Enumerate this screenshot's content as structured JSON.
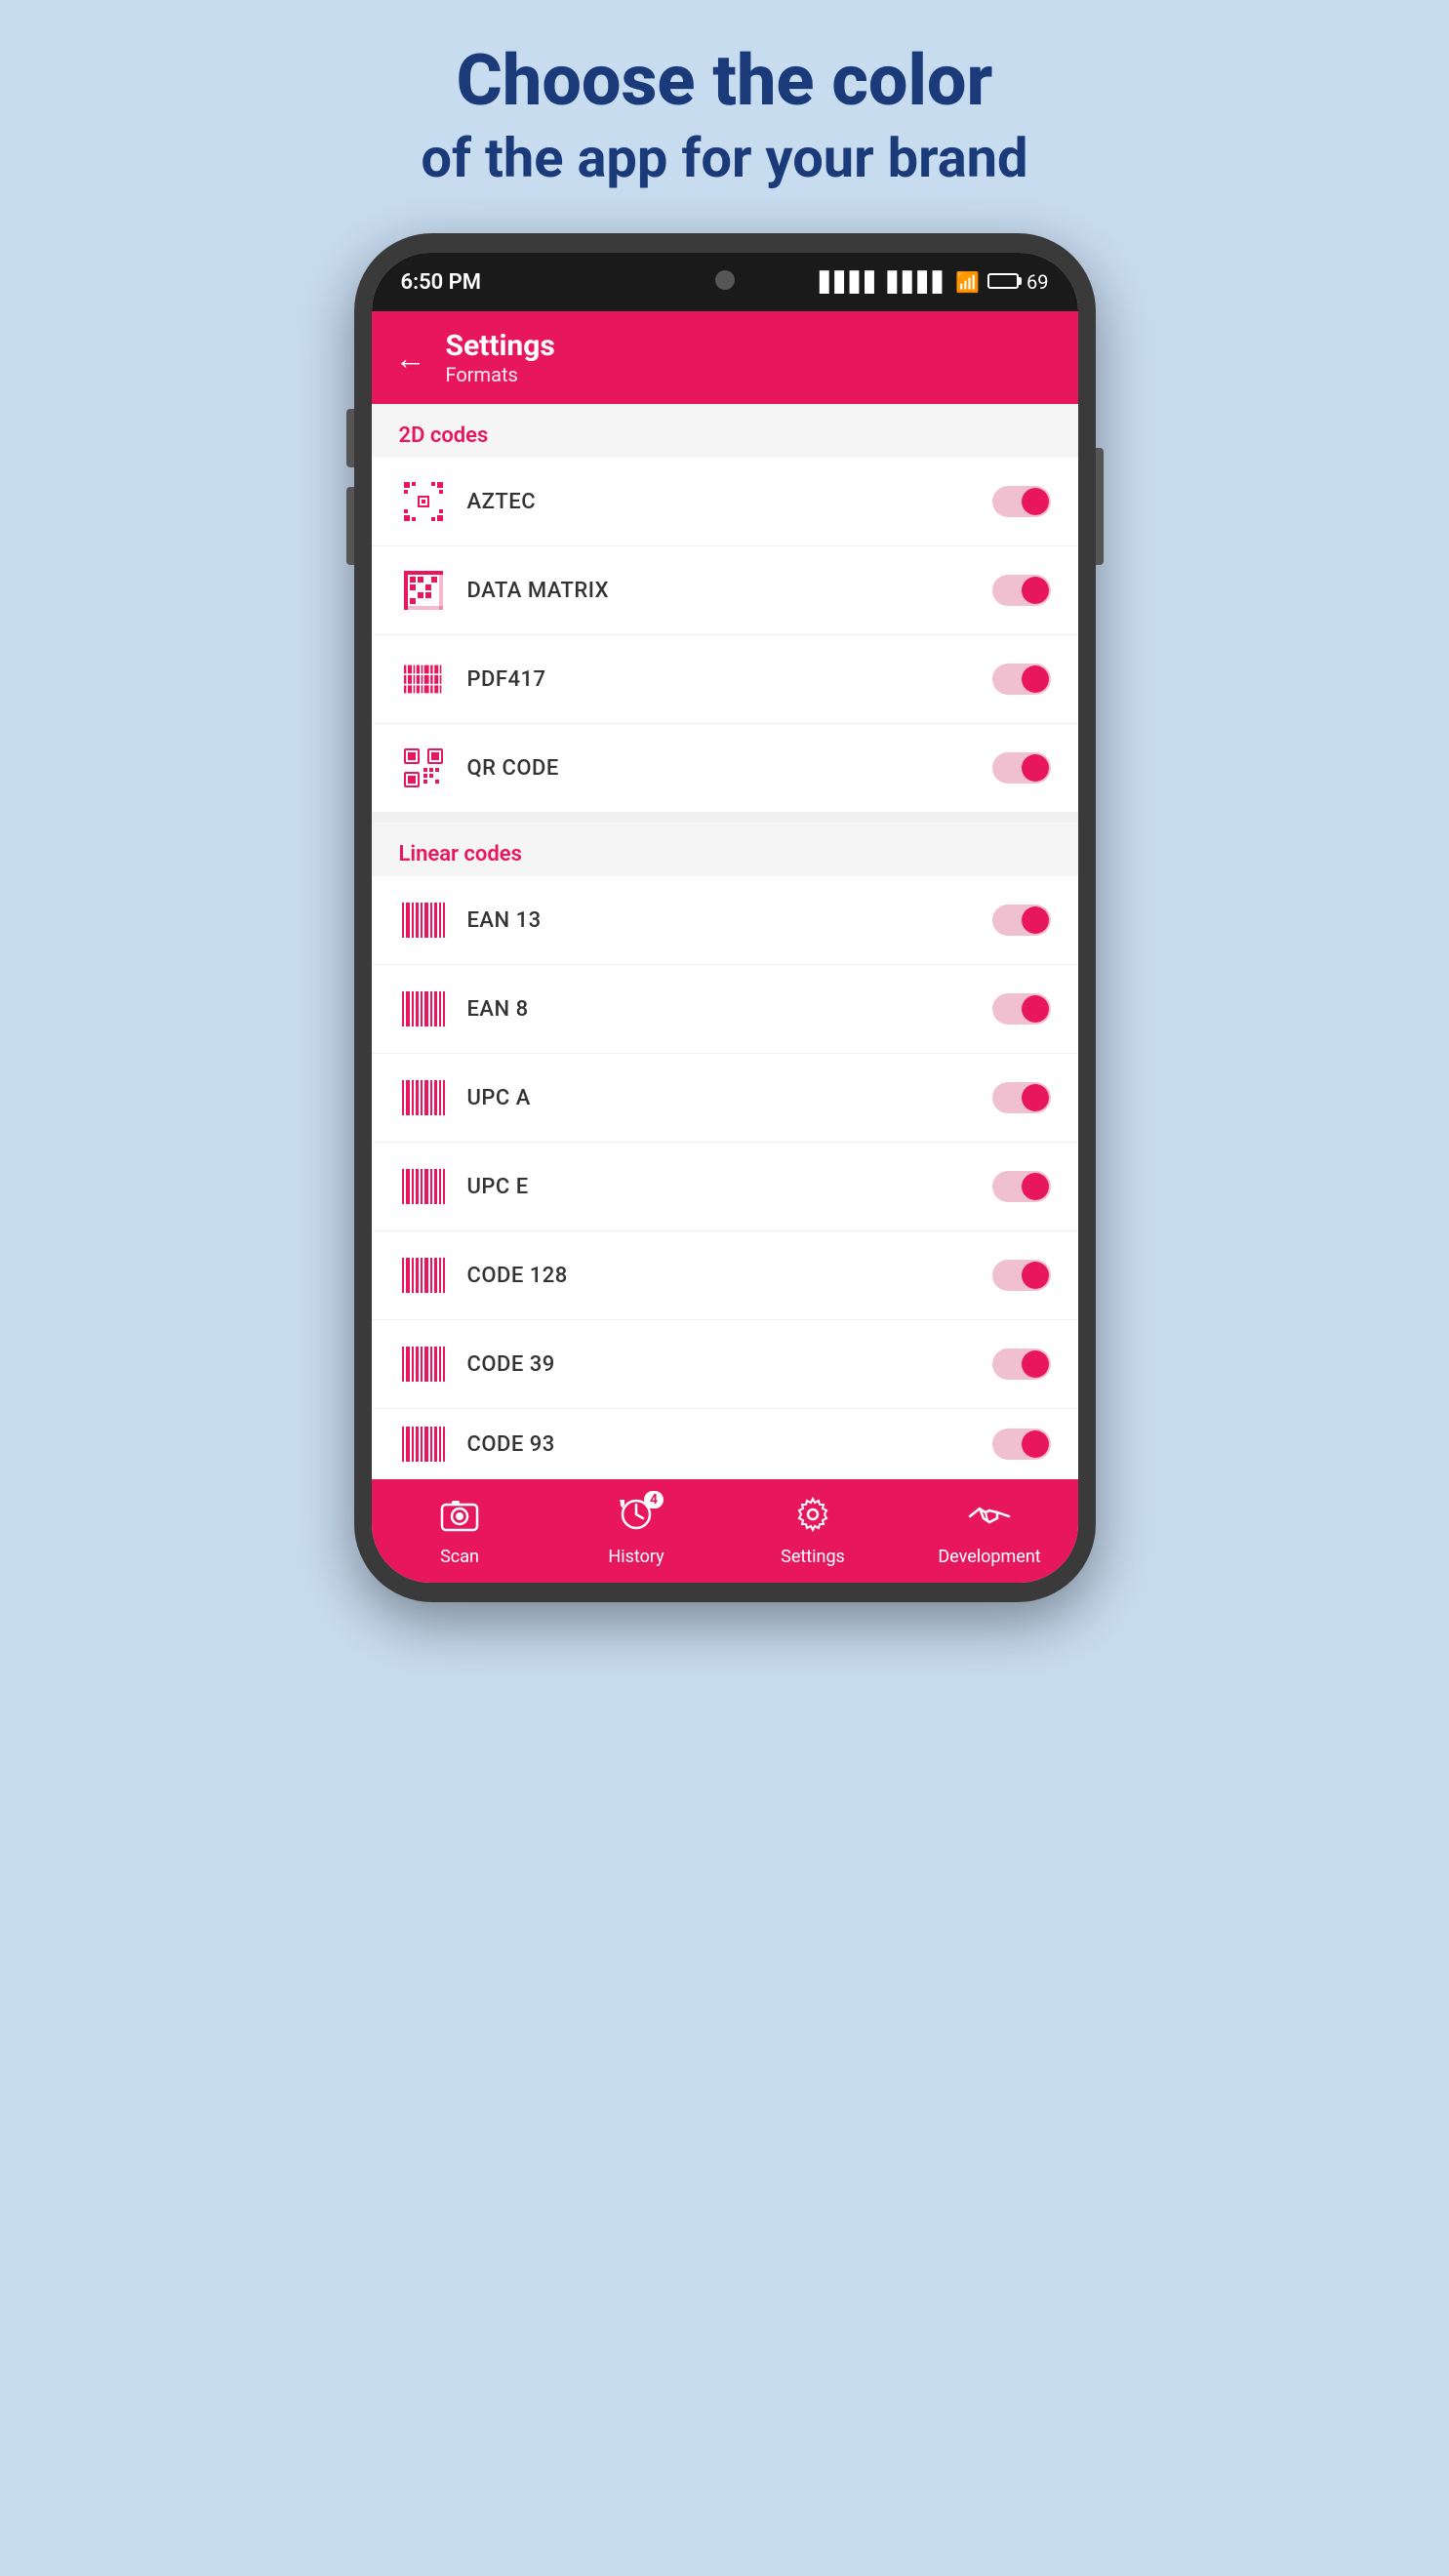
{
  "page": {
    "title_line1": "Choose the color",
    "title_line2": "of the app for your brand"
  },
  "status_bar": {
    "time": "6:50 PM",
    "signal1": "▋▋▋▋",
    "signal2": "▋▋▋▋",
    "battery_level": "69"
  },
  "header": {
    "back_label": "←",
    "title": "Settings",
    "subtitle": "Formats"
  },
  "sections": [
    {
      "id": "2d",
      "label": "2D codes",
      "items": [
        {
          "name": "AZTEC",
          "icon_type": "aztec",
          "enabled": true
        },
        {
          "name": "DATA MATRIX",
          "icon_type": "datamatrix",
          "enabled": true
        },
        {
          "name": "PDF417",
          "icon_type": "pdf417",
          "enabled": true
        },
        {
          "name": "QR CODE",
          "icon_type": "qr",
          "enabled": true
        }
      ]
    },
    {
      "id": "linear",
      "label": "Linear codes",
      "items": [
        {
          "name": "EAN 13",
          "icon_type": "barcode",
          "enabled": true
        },
        {
          "name": "EAN 8",
          "icon_type": "barcode",
          "enabled": true
        },
        {
          "name": "UPC A",
          "icon_type": "barcode",
          "enabled": true
        },
        {
          "name": "UPC E",
          "icon_type": "barcode",
          "enabled": true
        },
        {
          "name": "CODE 128",
          "icon_type": "barcode",
          "enabled": true
        },
        {
          "name": "CODE 39",
          "icon_type": "barcode",
          "enabled": true
        },
        {
          "name": "CODE 93",
          "icon_type": "barcode",
          "enabled": true
        }
      ]
    }
  ],
  "bottom_nav": {
    "items": [
      {
        "id": "scan",
        "label": "Scan",
        "icon": "camera",
        "badge": null
      },
      {
        "id": "history",
        "label": "History",
        "icon": "history",
        "badge": "4"
      },
      {
        "id": "settings",
        "label": "Settings",
        "icon": "settings",
        "badge": null
      },
      {
        "id": "development",
        "label": "Development",
        "icon": "handshake",
        "badge": null
      }
    ]
  },
  "accent_color": "#e8175d"
}
